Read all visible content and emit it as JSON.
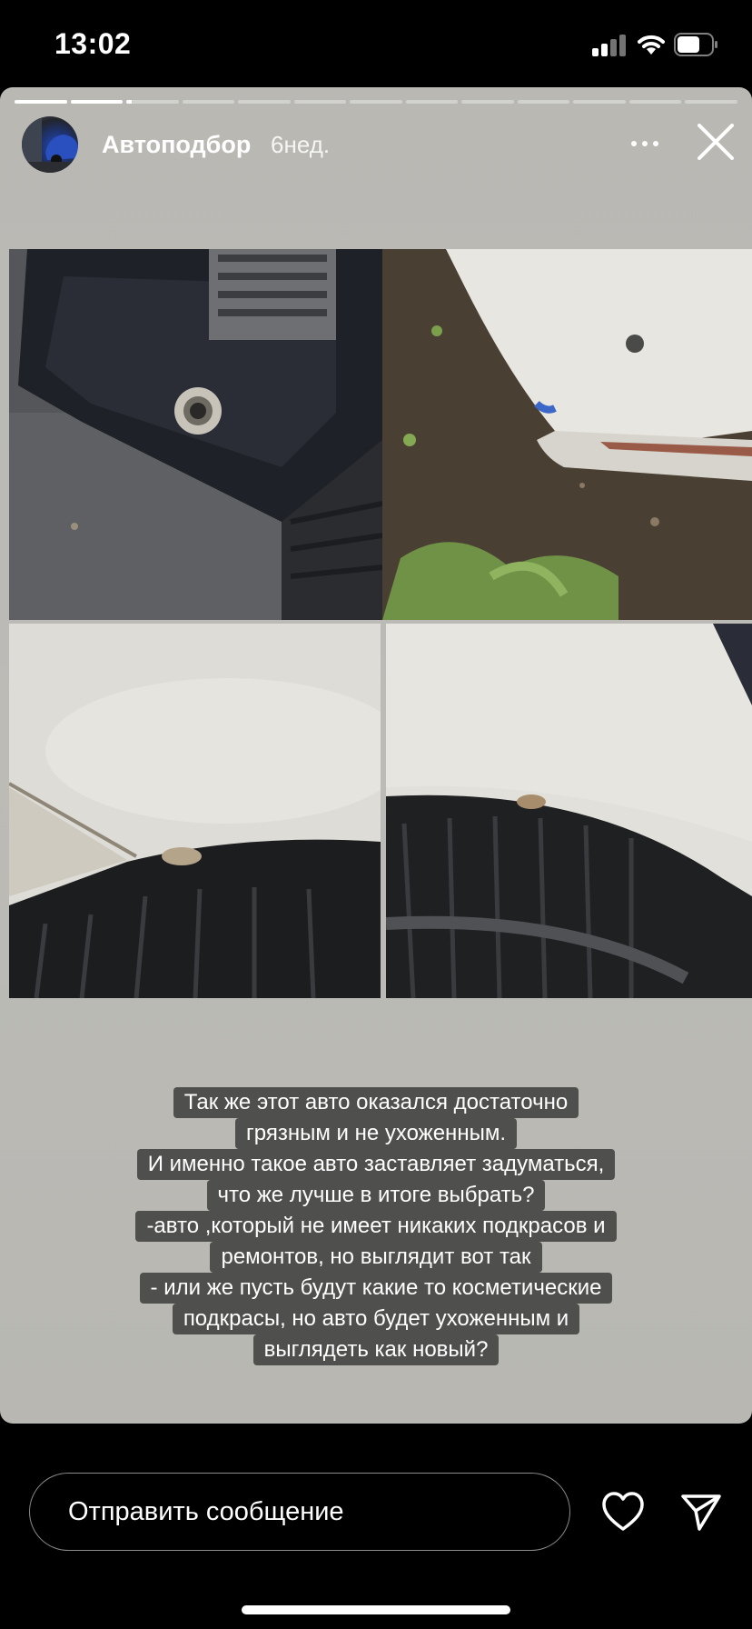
{
  "status_bar": {
    "time": "13:02"
  },
  "story": {
    "segments": [
      1,
      1,
      0.1,
      0,
      0,
      0,
      0,
      0,
      0,
      0,
      0,
      0,
      0
    ],
    "username": "Автоподбор",
    "time_ago": "6нед.",
    "caption_lines": [
      "Так же этот авто оказался достаточно",
      "грязным и не ухоженным.",
      "И именно такое авто заставляет задуматься,",
      "что же лучше в итоге выбрать?",
      "-авто ,который не имеет никаких подкрасов и",
      "ремонтов, но выглядит вот так",
      "- или же пусть будут какие то косметические",
      "подкрасы, но авто будет ухоженным и",
      "выглядеть как новый?"
    ]
  },
  "reply": {
    "placeholder": "Отправить сообщение"
  },
  "icons": [
    "more-icon",
    "close-icon",
    "heart-icon",
    "send-icon",
    "signal-icon",
    "wifi-icon",
    "battery-icon"
  ]
}
